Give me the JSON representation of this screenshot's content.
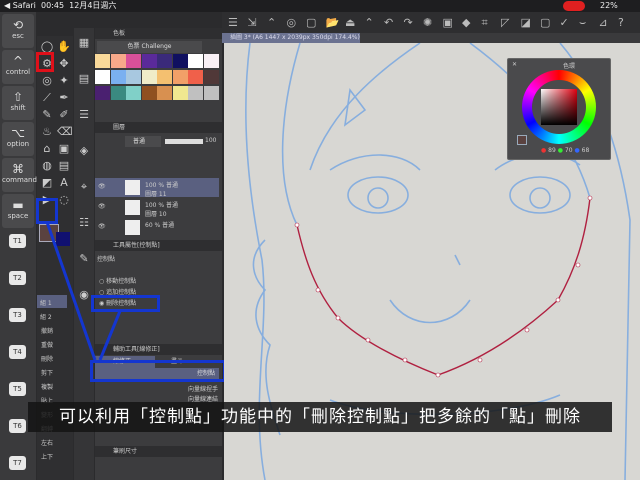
{
  "status": {
    "app": "◀ Safari",
    "time": "00:45",
    "date": "12月4日週六",
    "battery": "22%"
  },
  "keys": [
    {
      "icon": "⟲",
      "label": "esc"
    },
    {
      "icon": "^",
      "label": "control"
    },
    {
      "icon": "⇧",
      "label": "shift"
    },
    {
      "icon": "⌥",
      "label": "option"
    },
    {
      "icon": "⌘",
      "label": "command"
    },
    {
      "icon": "▬",
      "label": "space"
    }
  ],
  "tkeys": [
    "T1",
    "T2",
    "T3",
    "T4",
    "T5",
    "T6",
    "T7"
  ],
  "palette": {
    "tab": "色板",
    "set": "色票 Challenge",
    "colors": [
      "#f9d99a",
      "#f7a98a",
      "#d8509a",
      "#5a2a9a",
      "#3a2a7a",
      "#101060",
      "#ffffff",
      "#f8f0f5",
      "#ffffff",
      "#7ab0f0",
      "#a8c8e0",
      "#f0ecc8",
      "#f4c070",
      "#f2a068",
      "#f0604a",
      "#503838",
      "#4a2070",
      "#3a8a80",
      "#80d0c8",
      "#905020",
      "#d89050",
      "#f0e890",
      "#c0c0c0",
      "#c0c0c0"
    ]
  },
  "layers": {
    "tab": "圖層",
    "blend": "普通",
    "opacity": "100",
    "items": [
      {
        "info": "100 % 普通",
        "name": "圖層 11"
      },
      {
        "info": "100 % 普通",
        "name": "圖層 10"
      },
      {
        "info": "60 % 普通",
        "name": ""
      }
    ]
  },
  "tool_property": {
    "tab": "工具屬性[控制點]",
    "name": "控制點",
    "options": [
      "移動控制點",
      "追加控制點",
      "刪除控制點"
    ],
    "selected": 2
  },
  "sub_tool": {
    "tab": "輔助工具[線修正]",
    "tabs": [
      "線修正",
      "畫斗"
    ],
    "items": [
      "控制點",
      "向量線捏手",
      "向量線連結"
    ]
  },
  "sets": [
    "組 1",
    "組 2"
  ],
  "edit_cmds": [
    "撤銷",
    "重做",
    "刪除",
    "剪下",
    "複製",
    "貼上",
    "變形",
    "翻轉",
    "左右",
    "上下"
  ],
  "brush_size": {
    "tab": "筆刷尺寸"
  },
  "doc_tab": "插圖 3* (A6 1447 x 2039px 350dpi 174.4%)",
  "color_wheel": {
    "title": "色環",
    "r": "89",
    "g": "70",
    "b": "68",
    "main_color": "#5a4240",
    "sub_color": "#101070"
  },
  "subtitle": "可以利用「控制點」功能中的「刪除控制點」把多餘的「點」刪除",
  "colors": {
    "highlight": "#1436d0",
    "red_box": "#e0101a",
    "sketch": "#7aa8e0",
    "curve": "#b02040"
  }
}
